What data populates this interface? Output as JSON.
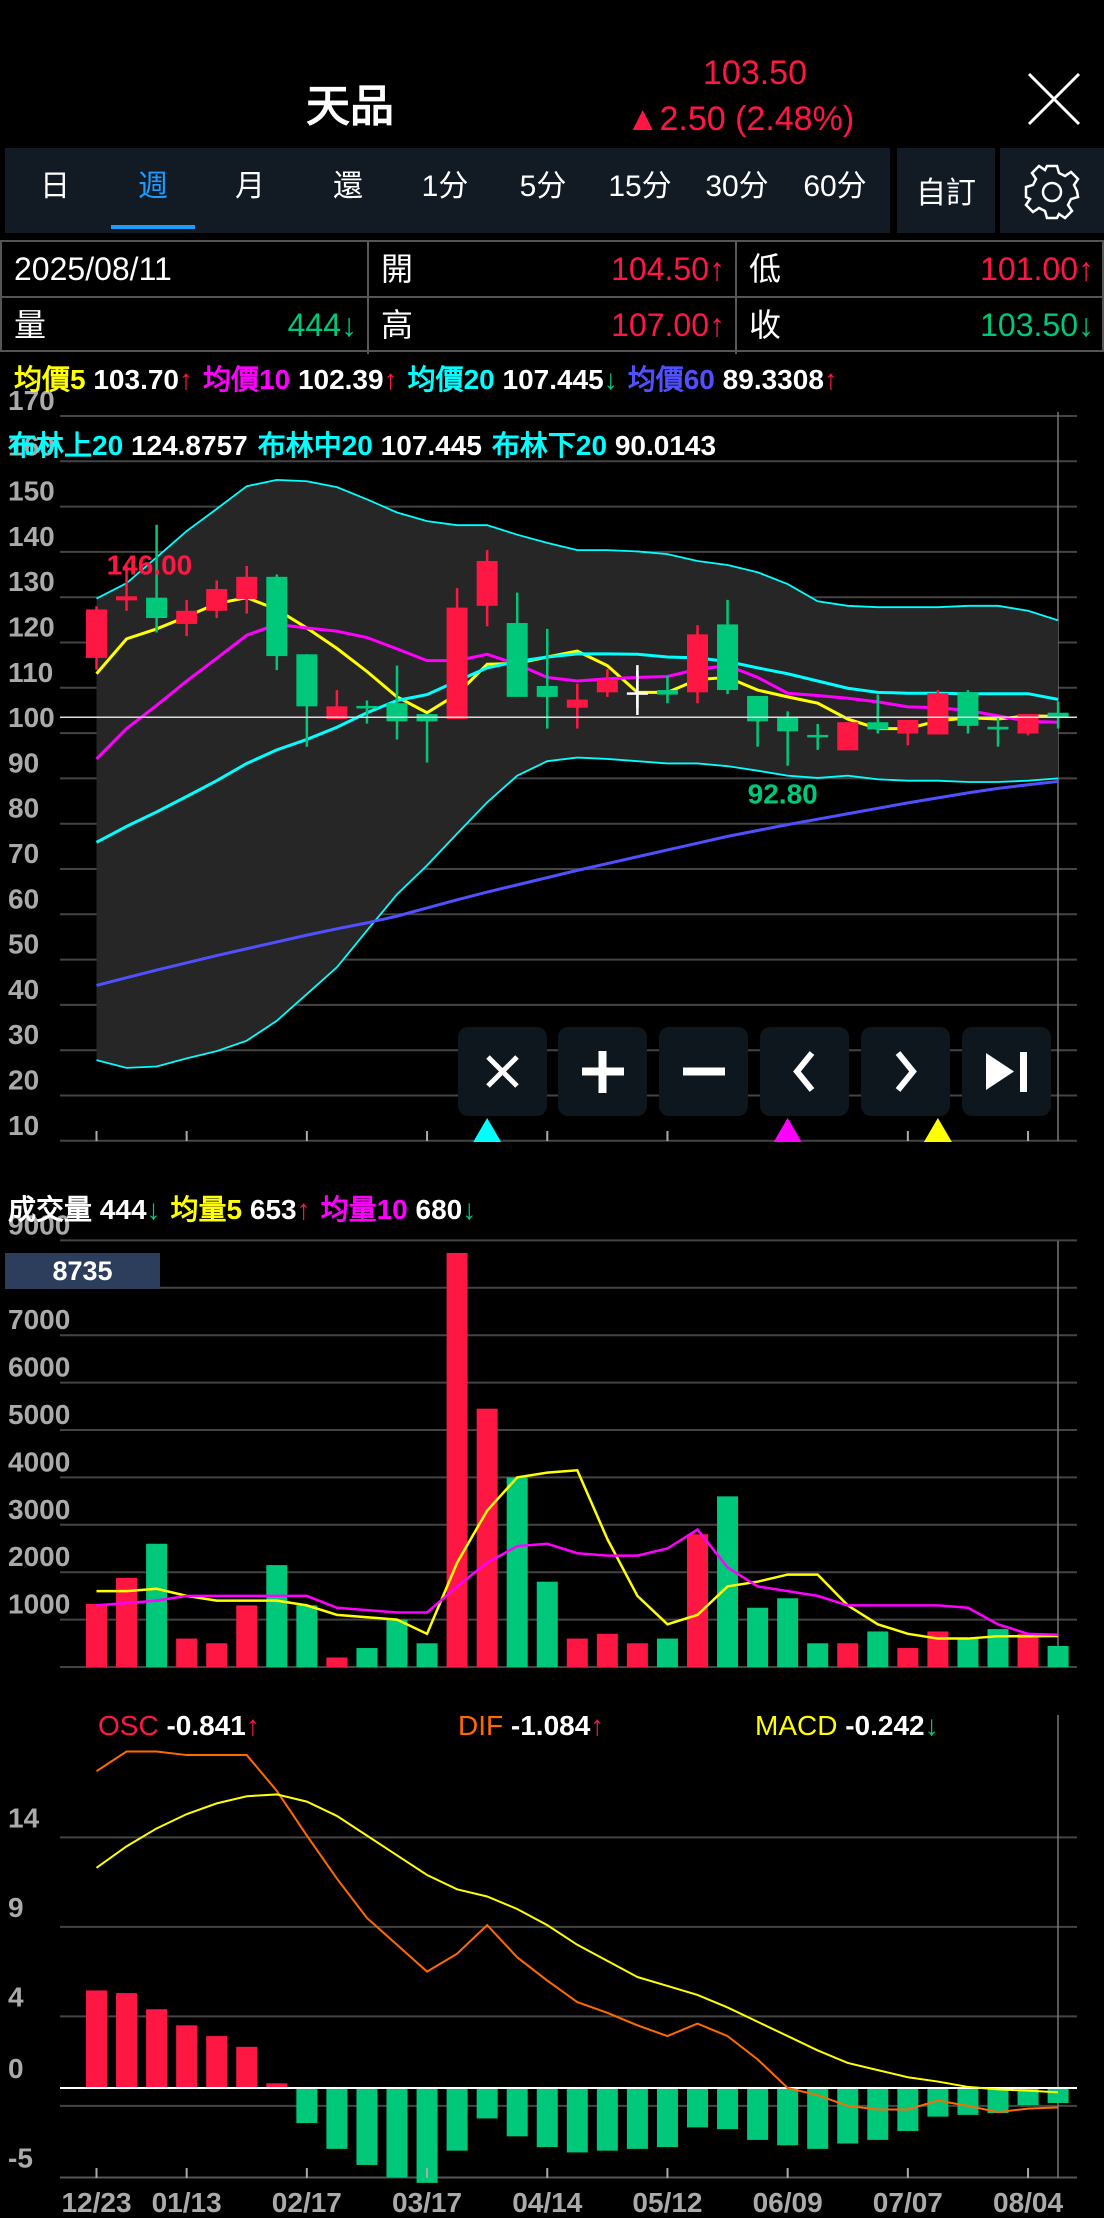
{
  "header": {
    "title": "天品",
    "price": "103.50",
    "change": "▲2.50 (2.48%)",
    "close_icon": "close-icon"
  },
  "tabs": [
    {
      "label": "日"
    },
    {
      "label": "週",
      "active": true
    },
    {
      "label": "月"
    },
    {
      "label": "還"
    },
    {
      "label": "1分"
    },
    {
      "label": "5分"
    },
    {
      "label": "15分"
    },
    {
      "label": "30分"
    },
    {
      "label": "60分"
    }
  ],
  "custom_label": "自訂",
  "settings_icon": "gear-icon",
  "info": {
    "date": "2025/08/11",
    "open_label": "開",
    "open": "104.50↑",
    "low_label": "低",
    "low": "101.00↑",
    "vol_label": "量",
    "vol": "444↓",
    "high_label": "高",
    "high": "107.00↑",
    "close_label": "收",
    "close": "103.50↓"
  },
  "ma": [
    {
      "label": "均價5",
      "value": "103.70",
      "arrow": "↑",
      "color": "#ffff00",
      "arrow_color": "#ff1744"
    },
    {
      "label": "均價10",
      "value": "102.39",
      "arrow": "↑",
      "color": "#ff00ff",
      "arrow_color": "#ff1744"
    },
    {
      "label": "均價20",
      "value": "107.445",
      "arrow": "↓",
      "color": "#00ffff",
      "arrow_color": "#00c87a"
    },
    {
      "label": "均價60",
      "value": "89.3308",
      "arrow": "↑",
      "color": "#5050ff",
      "arrow_color": "#ff1744"
    }
  ],
  "bb": [
    {
      "label": "布林上20",
      "value": "124.8757"
    },
    {
      "label": "布林中20",
      "value": "107.445"
    },
    {
      "label": "布林下20",
      "value": "90.0143"
    }
  ],
  "vol_header": [
    {
      "label": "成交量",
      "value": "444",
      "arrow": "↓",
      "color": "#ffffff",
      "arrow_color": "#00c87a"
    },
    {
      "label": "均量5",
      "value": "653",
      "arrow": "↑",
      "color": "#ffff00",
      "arrow_color": "#ff1744"
    },
    {
      "label": "均量10",
      "value": "680",
      "arrow": "↓",
      "color": "#ff00ff",
      "arrow_color": "#00c87a"
    }
  ],
  "vol_badge": "8735",
  "macd_header": [
    {
      "label": "OSC",
      "value": "-0.841",
      "arrow": "↑",
      "color": "#ff1744",
      "arrow_color": "#ff1744"
    },
    {
      "label": "DIF",
      "value": "-1.084",
      "arrow": "↑",
      "color": "#ff6a00",
      "arrow_color": "#ff1744"
    },
    {
      "label": "MACD",
      "value": "-0.242",
      "arrow": "↓",
      "color": "#ffff00",
      "arrow_color": "#00c87a"
    }
  ],
  "overlay_buttons": [
    {
      "name": "close-crosshair",
      "icon": "close-icon"
    },
    {
      "name": "zoom-in",
      "icon": "plus-icon"
    },
    {
      "name": "zoom-out",
      "icon": "minus-icon"
    },
    {
      "name": "previous",
      "icon": "chevron-left-icon"
    },
    {
      "name": "next",
      "icon": "chevron-right-icon"
    },
    {
      "name": "jump-to-latest",
      "icon": "skip-end-icon"
    }
  ],
  "colors": {
    "up": "#ff1744",
    "down": "#00c87a",
    "neutral": "#ffffff",
    "band_fill": "#262626"
  },
  "chart_data": [
    {
      "type": "candlestick",
      "title": "price",
      "ylim": [
        10,
        170
      ],
      "yticks": [
        170,
        160,
        150,
        140,
        130,
        120,
        110,
        100,
        90,
        80,
        70,
        60,
        50,
        40,
        30,
        20,
        10
      ],
      "xtick_labels": [
        "12/23",
        "01/13",
        "02/17",
        "03/17",
        "04/14",
        "05/12",
        "06/09",
        "07/07",
        "08/04"
      ],
      "xtick_index": [
        0,
        3,
        7,
        11,
        15,
        19,
        23,
        27,
        31
      ],
      "candles": [
        [
          116.6,
          128,
          114,
          127.3
        ],
        [
          129.3,
          137,
          127,
          130.2
        ],
        [
          129.9,
          146,
          122.2,
          125.4
        ],
        [
          124.1,
          129.4,
          121.4,
          127
        ],
        [
          127,
          133.7,
          125.4,
          131.8
        ],
        [
          129.6,
          136.9,
          126.4,
          134.5
        ],
        [
          134.5,
          135,
          113.9,
          117
        ],
        [
          117.4,
          117.4,
          97,
          105.9
        ],
        [
          103.1,
          109.5,
          103.1,
          105.9
        ],
        [
          106,
          107.2,
          102.1,
          105.6
        ],
        [
          106.6,
          114.9,
          98.6,
          102.6
        ],
        [
          104.2,
          104.2,
          93.5,
          102.6
        ],
        [
          103.1,
          132,
          103.1,
          127.7
        ],
        [
          128.1,
          140.4,
          123.6,
          138
        ],
        [
          124.3,
          131,
          108,
          108
        ],
        [
          110.4,
          123,
          101,
          108
        ],
        [
          105.6,
          110.9,
          101,
          107.4
        ],
        [
          109,
          114.1,
          108,
          111.7
        ],
        [
          109,
          113.8,
          105.6,
          109
        ],
        [
          109.5,
          112.7,
          106.6,
          108.5
        ],
        [
          109,
          123.8,
          106.6,
          121.8
        ],
        [
          124,
          129.4,
          108.6,
          109.5
        ],
        [
          108.2,
          108.2,
          97,
          102.6
        ],
        [
          103.4,
          104.8,
          92.8,
          100.4
        ],
        [
          99.6,
          102,
          96.3,
          99.1
        ],
        [
          96.2,
          102.4,
          96.2,
          102.4
        ],
        [
          102.4,
          108.5,
          99.9,
          100.8
        ],
        [
          99.9,
          102.9,
          97.3,
          102.9
        ],
        [
          99.7,
          109.5,
          99.7,
          108.8
        ],
        [
          109,
          109.5,
          99.9,
          101.6
        ],
        [
          101.4,
          103.4,
          97,
          100.8
        ],
        [
          99.9,
          104.2,
          99.5,
          104.2
        ],
        [
          104.5,
          107,
          101,
          103.5
        ]
      ],
      "series": [
        {
          "name": "均價5",
          "color": "#ffff00",
          "values": [
            113.1,
            120.8,
            123,
            125.7,
            128.6,
            129.9,
            127.3,
            123.2,
            118.7,
            113.6,
            108,
            104.5,
            108.6,
            115.2,
            115.4,
            116.8,
            118.1,
            114.9,
            109,
            109,
            111.8,
            112.3,
            109.5,
            108,
            106.6,
            103.1,
            101,
            101,
            102.7,
            103.4,
            103.1,
            103.8,
            103.7
          ]
        },
        {
          "name": "均價10",
          "color": "#ff00ff",
          "values": [
            94.3,
            101,
            106.1,
            111.5,
            116.5,
            121.6,
            124,
            123.2,
            122.5,
            121.1,
            118.6,
            116,
            116,
            117.4,
            115.2,
            112.3,
            111.5,
            112,
            112.3,
            112.5,
            114.1,
            114.9,
            112.3,
            108.8,
            108.3,
            107.7,
            106.9,
            105.8,
            105.6,
            105,
            103.8,
            102.6,
            102.39
          ]
        },
        {
          "name": "均價20",
          "color": "#00ffff",
          "values": [
            75.9,
            79.4,
            82.6,
            86,
            89.5,
            93.3,
            96.3,
            98.6,
            101.3,
            104.5,
            107.2,
            108.5,
            111.5,
            114.4,
            115.8,
            116.8,
            117.5,
            117.5,
            117.4,
            116.8,
            116.6,
            115.8,
            114.4,
            113.1,
            111.5,
            109.9,
            109,
            108.8,
            108.8,
            108.7,
            108.7,
            108.7,
            107.445
          ]
        },
        {
          "name": "均價60",
          "color": "#5050ff",
          "values": [
            44.3,
            46,
            47.7,
            49.3,
            50.9,
            52.4,
            53.9,
            55.4,
            56.8,
            58.1,
            59.6,
            61.4,
            63.2,
            64.9,
            66.5,
            68.1,
            69.7,
            71.2,
            72.7,
            74.2,
            75.7,
            77.2,
            78.5,
            79.8,
            81,
            82.2,
            83.4,
            84.6,
            85.7,
            86.8,
            87.8,
            88.6,
            89.3308
          ]
        }
      ],
      "bollinger": {
        "color": "#00ffff",
        "upper": [
          129.7,
          133.1,
          138.8,
          144.6,
          149.5,
          154.5,
          155.9,
          155.6,
          154.3,
          151.6,
          148.7,
          146.8,
          145.9,
          145.9,
          143.8,
          142,
          140.4,
          140.4,
          140.1,
          139.5,
          138,
          137.1,
          135.5,
          132.9,
          129.1,
          128.1,
          127.8,
          127.8,
          127.8,
          128.1,
          128.1,
          127,
          124.8757
        ],
        "lower": [
          27.8,
          26.1,
          26.4,
          28.2,
          29.8,
          32.1,
          36.5,
          42.4,
          48.3,
          56.4,
          64.4,
          70.8,
          77.8,
          84.7,
          90.6,
          93.8,
          94.6,
          94.3,
          93.8,
          93.3,
          93.3,
          92.7,
          91.7,
          90.6,
          90.1,
          90.6,
          89.8,
          89.5,
          89.5,
          89.2,
          89.2,
          89.5,
          90.0143
        ]
      },
      "annotations": {
        "high": {
          "label": "146.00",
          "index": 2
        },
        "low": {
          "label": "92.80",
          "index": 23
        }
      },
      "last_close": 103.5,
      "markers": [
        {
          "index": 13,
          "color": "#00ffff"
        },
        {
          "index": 23,
          "color": "#ff00ff"
        },
        {
          "index": 28,
          "color": "#ffff00"
        }
      ]
    },
    {
      "type": "bar",
      "title": "volume",
      "ylim": [
        0,
        9000
      ],
      "ytick_labels": [
        "9000",
        "7000",
        "6000",
        "5000",
        "4000",
        "3000",
        "2000",
        "1000"
      ],
      "yticks": [
        9000,
        7000,
        6000,
        5000,
        4000,
        3000,
        2000,
        1000
      ],
      "values": [
        1330,
        1880,
        2600,
        600,
        500,
        1300,
        2150,
        1300,
        200,
        400,
        1000,
        500,
        8735,
        5450,
        4000,
        1800,
        600,
        700,
        500,
        600,
        2800,
        3600,
        1250,
        1450,
        500,
        500,
        750,
        400,
        750,
        600,
        800,
        700,
        444
      ],
      "series": [
        {
          "name": "均量5",
          "color": "#ffff00",
          "values": [
            1600,
            1600,
            1650,
            1500,
            1400,
            1400,
            1400,
            1300,
            1100,
            1050,
            1000,
            700,
            2200,
            3300,
            4000,
            4100,
            4150,
            2700,
            1500,
            900,
            1100,
            1700,
            1800,
            1950,
            1950,
            1300,
            900,
            700,
            600,
            600,
            650,
            650,
            653
          ]
        },
        {
          "name": "均量10",
          "color": "#ff00ff",
          "values": [
            1300,
            1350,
            1400,
            1500,
            1500,
            1500,
            1500,
            1500,
            1250,
            1200,
            1150,
            1150,
            1700,
            2200,
            2550,
            2600,
            2400,
            2350,
            2350,
            2500,
            2900,
            2100,
            1700,
            1600,
            1500,
            1300,
            1300,
            1300,
            1300,
            1250,
            900,
            700,
            680
          ]
        }
      ]
    },
    {
      "type": "bar",
      "title": "MACD",
      "ylim": [
        -5,
        19
      ],
      "ytick_labels": [
        "14",
        "9",
        "4",
        "0",
        "-5"
      ],
      "yticks": [
        14,
        9,
        4,
        0,
        -5
      ],
      "xtick_labels": [
        "12/23",
        "01/13",
        "02/17",
        "03/17",
        "04/14",
        "05/12",
        "06/09",
        "07/07",
        "08/04"
      ],
      "xtick_index": [
        0,
        3,
        7,
        11,
        15,
        19,
        23,
        27,
        31
      ],
      "osc": [
        5.45,
        5.3,
        4.4,
        3.5,
        2.9,
        2.3,
        0.26,
        -1.96,
        -3.4,
        -4.3,
        -5,
        -5.3,
        -3.5,
        -1.7,
        -2.7,
        -3.3,
        -3.6,
        -3.5,
        -3.4,
        -3.3,
        -2.2,
        -2.3,
        -2.9,
        -3.2,
        -3.4,
        -3.1,
        -2.9,
        -2.4,
        -1.6,
        -1.5,
        -1.4,
        -0.95,
        -0.841
      ],
      "series": [
        {
          "name": "DIF",
          "color": "#ff6a00",
          "values": [
            17.7,
            18.8,
            18.8,
            18.6,
            18.6,
            18.6,
            16.6,
            14.1,
            11.7,
            9.5,
            8,
            6.5,
            7.5,
            9.1,
            7.3,
            6,
            4.8,
            4.2,
            3.5,
            2.9,
            3.6,
            2.9,
            1.6,
            0,
            -0.4,
            -1,
            -1.2,
            -1.2,
            -0.7,
            -1,
            -1.35,
            -1.15,
            -1.084
          ]
        },
        {
          "name": "MACD",
          "color": "#ffff00",
          "values": [
            12.3,
            13.5,
            14.5,
            15.3,
            15.9,
            16.3,
            16.4,
            16,
            15.2,
            14.1,
            13,
            11.9,
            11.1,
            10.7,
            10,
            9.1,
            8,
            7.1,
            6.2,
            5.7,
            5.2,
            4.5,
            3.7,
            2.9,
            2.1,
            1.4,
            1,
            0.6,
            0.36,
            0.06,
            -0.08,
            -0.15,
            -0.242
          ]
        }
      ]
    }
  ]
}
